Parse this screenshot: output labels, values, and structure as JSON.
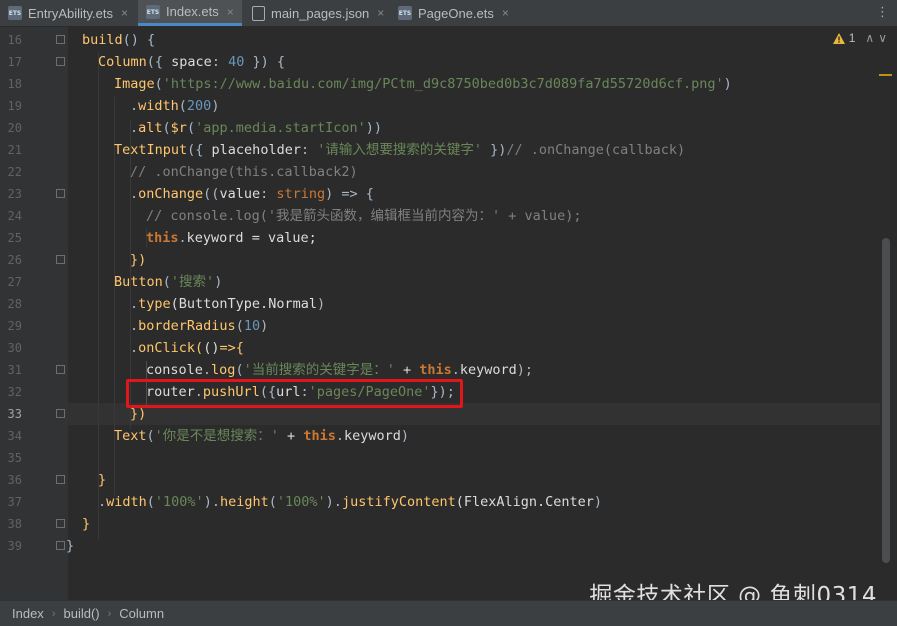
{
  "tabs": [
    {
      "label": "EntryAbility.ets",
      "icon": "ets-file-icon",
      "active": false
    },
    {
      "label": "Index.ets",
      "icon": "ets-file-icon",
      "active": true
    },
    {
      "label": "main_pages.json",
      "icon": "json-file-icon",
      "active": false
    },
    {
      "label": "PageOne.ets",
      "icon": "ets-file-icon",
      "active": false
    }
  ],
  "tab_close_glyph": "×",
  "tab_more_glyph": "⋮",
  "inspections": {
    "warnings": "1",
    "up": "∧",
    "down": "∨"
  },
  "line_numbers": [
    "16",
    "17",
    "18",
    "19",
    "20",
    "21",
    "22",
    "23",
    "24",
    "25",
    "26",
    "27",
    "28",
    "29",
    "30",
    "31",
    "32",
    "33",
    "34",
    "35",
    "36",
    "37",
    "38",
    "39"
  ],
  "current_line": "33",
  "code": {
    "l16": {
      "a": "build",
      "b": "() {"
    },
    "l17": {
      "a": "Column",
      "b": "({ ",
      "c": "space",
      "d": ": ",
      "e": "40",
      "f": " }) {"
    },
    "l18": {
      "a": "Image",
      "b": "(",
      "c": "'https://www.baidu.com/img/PCtm_d9c8750bed0b3c7d089fa7d55720d6cf.png'",
      "d": ")"
    },
    "l19": {
      "a": ".",
      "b": "width",
      "c": "(",
      "d": "200",
      "e": ")"
    },
    "l20": {
      "a": ".",
      "b": "alt",
      "c": "(",
      "d": "$r",
      "e": "(",
      "f": "'app.media.startIcon'",
      "g": "))"
    },
    "l21": {
      "a": "TextInput",
      "b": "({ ",
      "c": "placeholder",
      "d": ": ",
      "e": "'请输入想要搜索的关键字'",
      "f": " })",
      "g": "// .onChange(callback)"
    },
    "l22": {
      "a": "// .onChange(this.callback2)"
    },
    "l23": {
      "a": ".",
      "b": "onChange",
      "c": "((",
      "d": "value",
      "e": ": ",
      "f": "string",
      "g": ") => {"
    },
    "l24": {
      "a": "// console.log('我是箭头函数，编辑框当前内容为：' + value);"
    },
    "l25": {
      "a": "this",
      "b": ".",
      "c": "keyword",
      "d": " = value;"
    },
    "l26": {
      "a": "})"
    },
    "l27": {
      "a": "Button",
      "b": "(",
      "c": "'搜索'",
      "d": ")"
    },
    "l28": {
      "a": ".",
      "b": "type",
      "c": "(ButtonType.",
      "d": "Normal",
      "e": ")"
    },
    "l29": {
      "a": ".",
      "b": "borderRadius",
      "c": "(",
      "d": "10",
      "e": ")"
    },
    "l30": {
      "a": ".",
      "b": "onClick",
      "c": "(",
      "d": "()",
      "e": "=>{"
    },
    "l31": {
      "a": "console",
      "b": ".",
      "c": "log",
      "d": "(",
      "e": "'当前搜索的关键字是：'",
      "f": " + ",
      "g": "this",
      "h": ".",
      "i": "keyword",
      "j": ");"
    },
    "l32": {
      "a": "router",
      "b": ".",
      "c": "pushUrl",
      "d": "({",
      "e": "url",
      "f": ":",
      "g": "'pages/PageOne'",
      "h": "});"
    },
    "l33": {
      "a": "})"
    },
    "l34": {
      "a": "Text",
      "b": "(",
      "c": "'你是不是想搜索：'",
      "d": " + ",
      "e": "this",
      "f": ".",
      "g": "keyword",
      "h": ")"
    },
    "l35": {},
    "l36": {
      "a": "}"
    },
    "l37": {
      "a": ".",
      "b": "width",
      "c": "(",
      "d": "'100%'",
      "e": ").",
      "f": "height",
      "g": "(",
      "h": "'100%'",
      "i": ").",
      "j": "justifyContent",
      "k": "(FlexAlign.",
      "l": "Center",
      "m": ")"
    },
    "l38": {
      "a": "}"
    },
    "l39": {
      "a": "}"
    }
  },
  "watermark": "掘金技术社区 @ 鱼刺0314",
  "breadcrumb": [
    "Index",
    "build()",
    "Column"
  ],
  "colors": {
    "highlight_box": "#e0161b",
    "accent": "#4a88c7"
  }
}
